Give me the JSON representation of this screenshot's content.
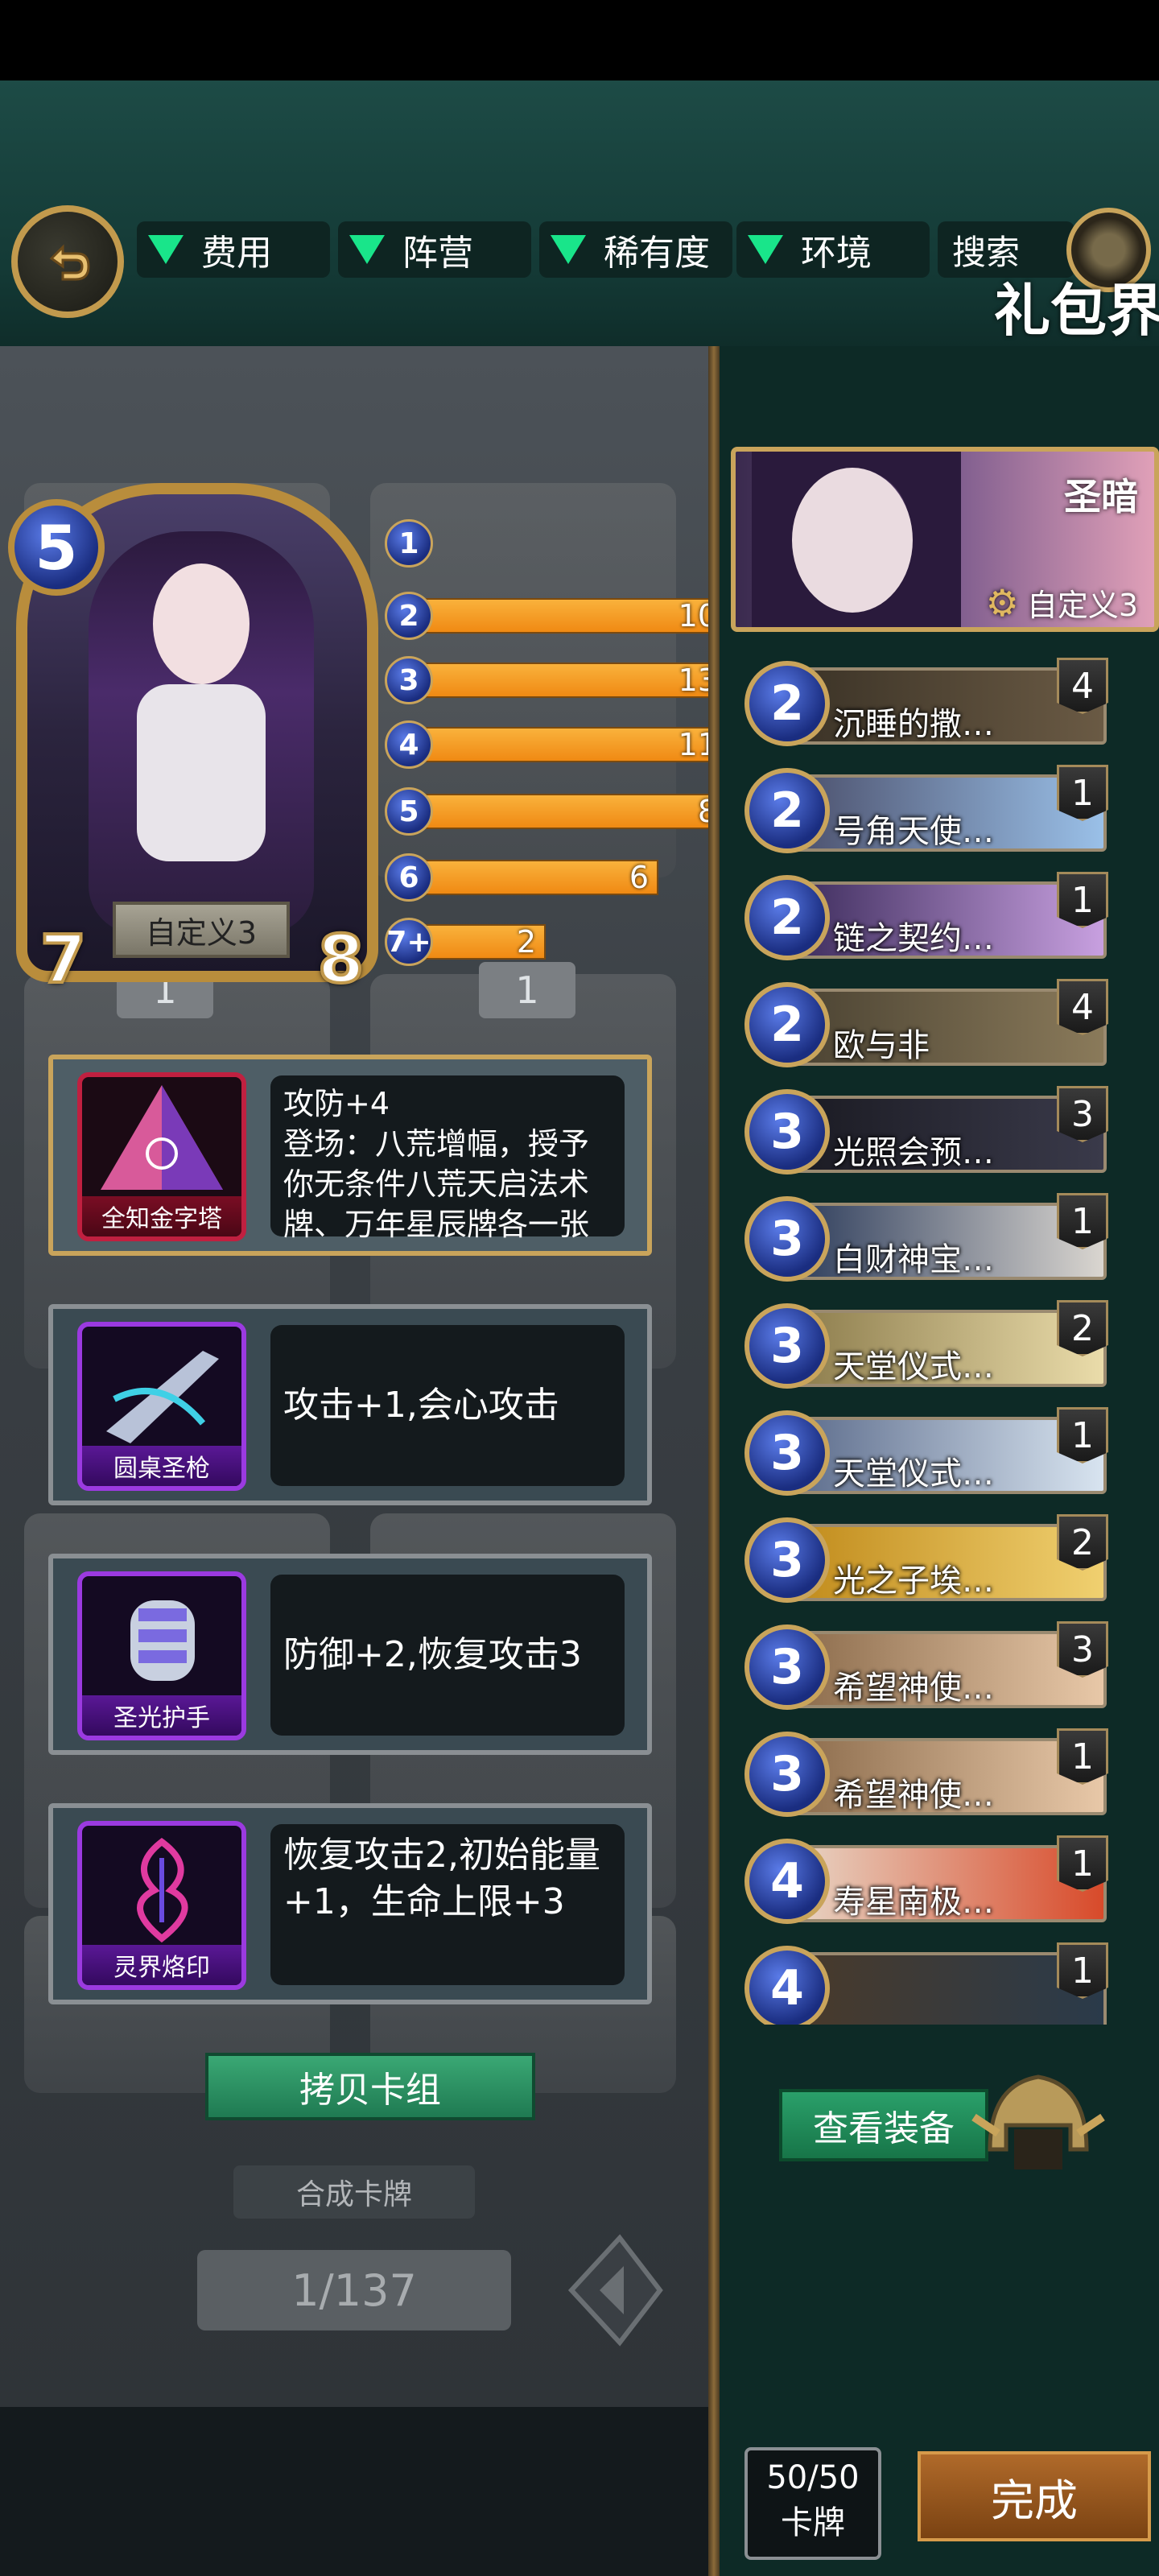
{
  "filters": [
    {
      "label": "费用"
    },
    {
      "label": "阵营"
    },
    {
      "label": "稀有度"
    },
    {
      "label": "环境"
    }
  ],
  "search_label": "搜索",
  "pack_title": "礼包界",
  "hero_card": {
    "cost": "5",
    "name": "自定义3",
    "attack": "7",
    "health": "8"
  },
  "mana_curve": [
    {
      "cost": "1",
      "count": ""
    },
    {
      "cost": "2",
      "count": "10"
    },
    {
      "cost": "3",
      "count": "13"
    },
    {
      "cost": "4",
      "count": "11"
    },
    {
      "cost": "5",
      "count": "8"
    },
    {
      "cost": "6",
      "count": "6"
    },
    {
      "cost": "7+",
      "count": "2"
    }
  ],
  "equipment": [
    {
      "name": "全知金字塔",
      "desc": "攻防+4\n登场：八荒增幅，授予你无条件八荒天启法术牌、万年星辰牌各一张"
    },
    {
      "name": "圆桌圣枪",
      "desc": "攻击+1,会心攻击"
    },
    {
      "name": "圣光护手",
      "desc": "防御+2,恢复攻击3"
    },
    {
      "name": "灵界烙印",
      "desc": "恢复攻击2,初始能量+1，生命上限+3"
    }
  ],
  "copy_deck_label": "拷贝卡组",
  "synth_label": "合成卡牌",
  "page_indicator": "1/137",
  "deck_banner": {
    "title": "圣暗",
    "subtitle": "自定义3"
  },
  "deck_list": [
    {
      "cost": "2",
      "name": "沉睡的撒…",
      "count": "4"
    },
    {
      "cost": "2",
      "name": "号角天使…",
      "count": "1"
    },
    {
      "cost": "2",
      "name": "链之契约…",
      "count": "1"
    },
    {
      "cost": "2",
      "name": "欧与非",
      "count": "4"
    },
    {
      "cost": "3",
      "name": "光照会预…",
      "count": "3"
    },
    {
      "cost": "3",
      "name": "白财神宝…",
      "count": "1"
    },
    {
      "cost": "3",
      "name": "天堂仪式…",
      "count": "2"
    },
    {
      "cost": "3",
      "name": "天堂仪式…",
      "count": "1"
    },
    {
      "cost": "3",
      "name": "光之子埃…",
      "count": "2"
    },
    {
      "cost": "3",
      "name": "希望神使…",
      "count": "3"
    },
    {
      "cost": "3",
      "name": "希望神使…",
      "count": "1"
    },
    {
      "cost": "4",
      "name": "寿星南极…",
      "count": "1"
    },
    {
      "cost": "4",
      "name": "",
      "count": "1"
    }
  ],
  "view_equipment_label": "查看装备",
  "deck_count": {
    "value": "50/50",
    "label": "卡牌"
  },
  "done_label": "完成",
  "colors": {
    "teal_header": "#1d4b46",
    "gold": "#c9a45b",
    "orange_bar": "#f4a02a",
    "green_button": "#2aa06a",
    "done_button": "#b06a2a"
  }
}
